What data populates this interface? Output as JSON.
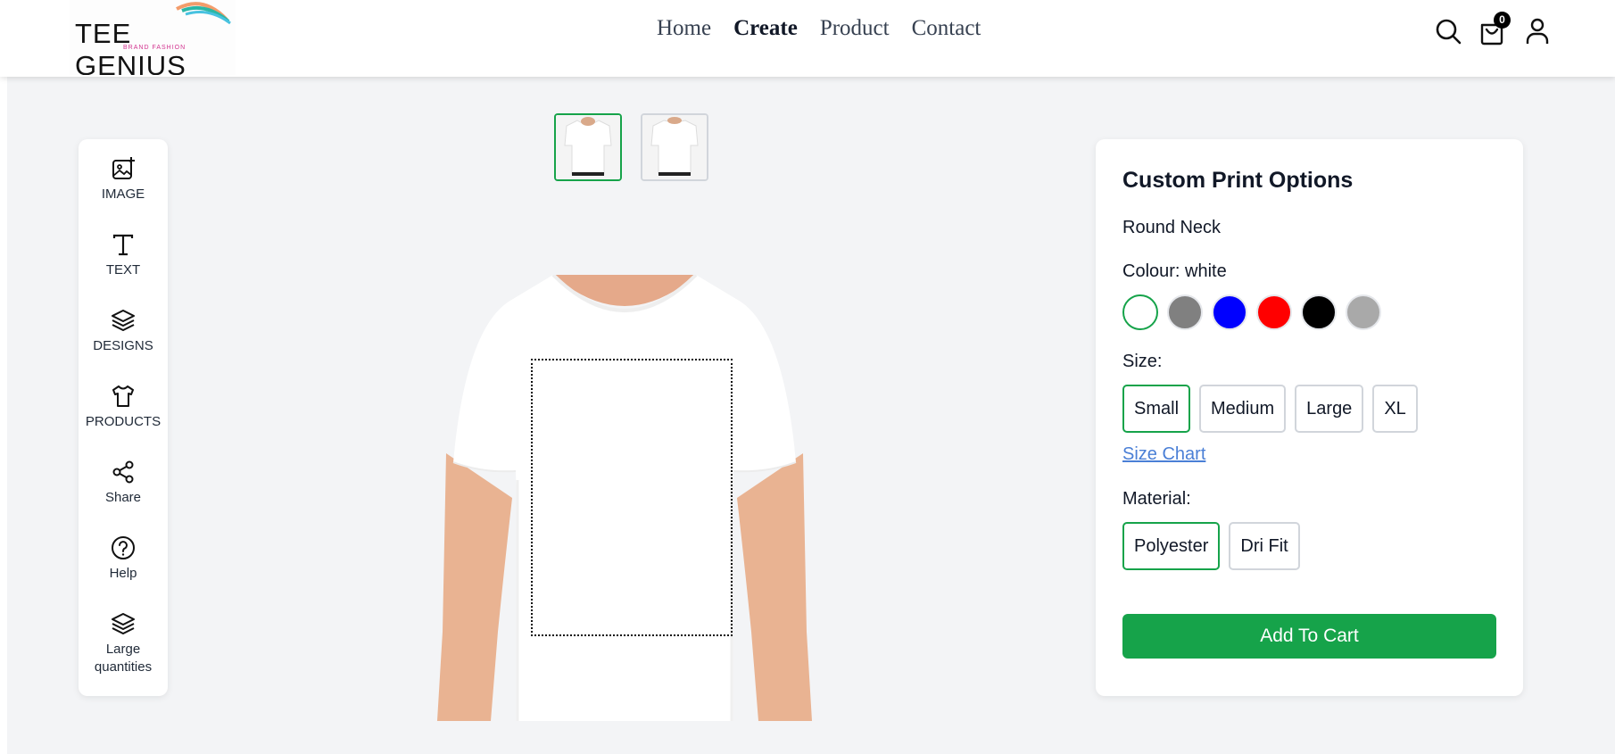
{
  "brand": {
    "name": "TEE GENIUS",
    "tagline": "BRAND FASHION"
  },
  "nav": {
    "items": [
      {
        "label": "Home",
        "active": false
      },
      {
        "label": "Create",
        "active": true
      },
      {
        "label": "Product",
        "active": false
      },
      {
        "label": "Contact",
        "active": false
      }
    ]
  },
  "header": {
    "cart_count": "0",
    "icons": [
      "search-icon",
      "shopping-bag-icon",
      "user-icon"
    ]
  },
  "toolbar": {
    "items": [
      {
        "label": "IMAGE",
        "icon": "image-add-icon"
      },
      {
        "label": "TEXT",
        "icon": "text-icon"
      },
      {
        "label": "DESIGNS",
        "icon": "layers-icon"
      },
      {
        "label": "PRODUCTS",
        "icon": "tshirt-icon"
      },
      {
        "label": "Share",
        "icon": "share-icon"
      },
      {
        "label": "Help",
        "icon": "help-icon"
      },
      {
        "label": "Large quantities",
        "icon": "layers-icon"
      }
    ]
  },
  "views": {
    "items": [
      "front",
      "back"
    ],
    "selected": "front"
  },
  "options": {
    "title": "Custom Print Options",
    "product_type": "Round Neck",
    "colour_label": "Colour: white",
    "colours": [
      "#ffffff",
      "#808080",
      "#0000ff",
      "#ff0000",
      "#000000",
      "#a9a9a9"
    ],
    "selected_colour": "#ffffff",
    "size_label": "Size:",
    "sizes": [
      "Small",
      "Medium",
      "Large",
      "XL"
    ],
    "selected_size": "Small",
    "size_chart_label": "Size Chart",
    "material_label": "Material:",
    "materials": [
      "Polyester",
      "Dri Fit"
    ],
    "selected_material": "Polyester",
    "add_to_cart_label": "Add To Cart"
  },
  "colors": {
    "accent": "#16a34a",
    "link": "#4a7fd6",
    "workspace_bg": "#f3f4f6"
  }
}
